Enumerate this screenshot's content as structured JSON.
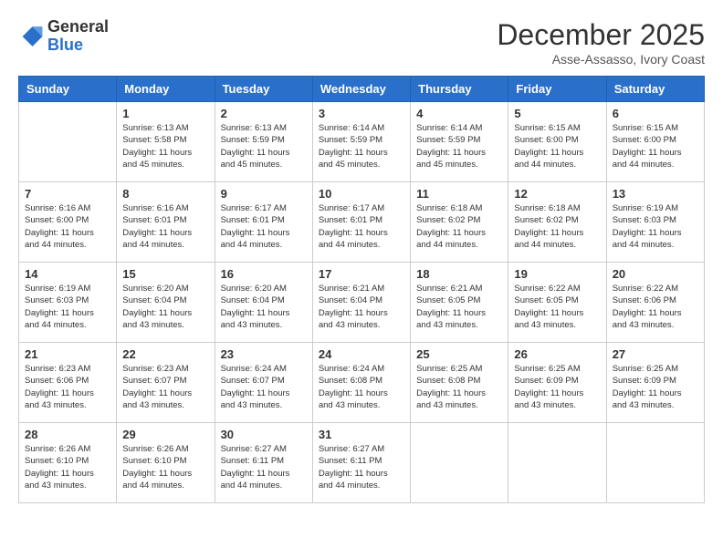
{
  "header": {
    "logo_general": "General",
    "logo_blue": "Blue",
    "month_title": "December 2025",
    "location": "Asse-Assasso, Ivory Coast"
  },
  "calendar": {
    "days_of_week": [
      "Sunday",
      "Monday",
      "Tuesday",
      "Wednesday",
      "Thursday",
      "Friday",
      "Saturday"
    ],
    "weeks": [
      [
        {
          "day": "",
          "info": ""
        },
        {
          "day": "1",
          "info": "Sunrise: 6:13 AM\nSunset: 5:58 PM\nDaylight: 11 hours\nand 45 minutes."
        },
        {
          "day": "2",
          "info": "Sunrise: 6:13 AM\nSunset: 5:59 PM\nDaylight: 11 hours\nand 45 minutes."
        },
        {
          "day": "3",
          "info": "Sunrise: 6:14 AM\nSunset: 5:59 PM\nDaylight: 11 hours\nand 45 minutes."
        },
        {
          "day": "4",
          "info": "Sunrise: 6:14 AM\nSunset: 5:59 PM\nDaylight: 11 hours\nand 45 minutes."
        },
        {
          "day": "5",
          "info": "Sunrise: 6:15 AM\nSunset: 6:00 PM\nDaylight: 11 hours\nand 44 minutes."
        },
        {
          "day": "6",
          "info": "Sunrise: 6:15 AM\nSunset: 6:00 PM\nDaylight: 11 hours\nand 44 minutes."
        }
      ],
      [
        {
          "day": "7",
          "info": "Sunrise: 6:16 AM\nSunset: 6:00 PM\nDaylight: 11 hours\nand 44 minutes."
        },
        {
          "day": "8",
          "info": "Sunrise: 6:16 AM\nSunset: 6:01 PM\nDaylight: 11 hours\nand 44 minutes."
        },
        {
          "day": "9",
          "info": "Sunrise: 6:17 AM\nSunset: 6:01 PM\nDaylight: 11 hours\nand 44 minutes."
        },
        {
          "day": "10",
          "info": "Sunrise: 6:17 AM\nSunset: 6:01 PM\nDaylight: 11 hours\nand 44 minutes."
        },
        {
          "day": "11",
          "info": "Sunrise: 6:18 AM\nSunset: 6:02 PM\nDaylight: 11 hours\nand 44 minutes."
        },
        {
          "day": "12",
          "info": "Sunrise: 6:18 AM\nSunset: 6:02 PM\nDaylight: 11 hours\nand 44 minutes."
        },
        {
          "day": "13",
          "info": "Sunrise: 6:19 AM\nSunset: 6:03 PM\nDaylight: 11 hours\nand 44 minutes."
        }
      ],
      [
        {
          "day": "14",
          "info": "Sunrise: 6:19 AM\nSunset: 6:03 PM\nDaylight: 11 hours\nand 44 minutes."
        },
        {
          "day": "15",
          "info": "Sunrise: 6:20 AM\nSunset: 6:04 PM\nDaylight: 11 hours\nand 43 minutes."
        },
        {
          "day": "16",
          "info": "Sunrise: 6:20 AM\nSunset: 6:04 PM\nDaylight: 11 hours\nand 43 minutes."
        },
        {
          "day": "17",
          "info": "Sunrise: 6:21 AM\nSunset: 6:04 PM\nDaylight: 11 hours\nand 43 minutes."
        },
        {
          "day": "18",
          "info": "Sunrise: 6:21 AM\nSunset: 6:05 PM\nDaylight: 11 hours\nand 43 minutes."
        },
        {
          "day": "19",
          "info": "Sunrise: 6:22 AM\nSunset: 6:05 PM\nDaylight: 11 hours\nand 43 minutes."
        },
        {
          "day": "20",
          "info": "Sunrise: 6:22 AM\nSunset: 6:06 PM\nDaylight: 11 hours\nand 43 minutes."
        }
      ],
      [
        {
          "day": "21",
          "info": "Sunrise: 6:23 AM\nSunset: 6:06 PM\nDaylight: 11 hours\nand 43 minutes."
        },
        {
          "day": "22",
          "info": "Sunrise: 6:23 AM\nSunset: 6:07 PM\nDaylight: 11 hours\nand 43 minutes."
        },
        {
          "day": "23",
          "info": "Sunrise: 6:24 AM\nSunset: 6:07 PM\nDaylight: 11 hours\nand 43 minutes."
        },
        {
          "day": "24",
          "info": "Sunrise: 6:24 AM\nSunset: 6:08 PM\nDaylight: 11 hours\nand 43 minutes."
        },
        {
          "day": "25",
          "info": "Sunrise: 6:25 AM\nSunset: 6:08 PM\nDaylight: 11 hours\nand 43 minutes."
        },
        {
          "day": "26",
          "info": "Sunrise: 6:25 AM\nSunset: 6:09 PM\nDaylight: 11 hours\nand 43 minutes."
        },
        {
          "day": "27",
          "info": "Sunrise: 6:25 AM\nSunset: 6:09 PM\nDaylight: 11 hours\nand 43 minutes."
        }
      ],
      [
        {
          "day": "28",
          "info": "Sunrise: 6:26 AM\nSunset: 6:10 PM\nDaylight: 11 hours\nand 43 minutes."
        },
        {
          "day": "29",
          "info": "Sunrise: 6:26 AM\nSunset: 6:10 PM\nDaylight: 11 hours\nand 44 minutes."
        },
        {
          "day": "30",
          "info": "Sunrise: 6:27 AM\nSunset: 6:11 PM\nDaylight: 11 hours\nand 44 minutes."
        },
        {
          "day": "31",
          "info": "Sunrise: 6:27 AM\nSunset: 6:11 PM\nDaylight: 11 hours\nand 44 minutes."
        },
        {
          "day": "",
          "info": ""
        },
        {
          "day": "",
          "info": ""
        },
        {
          "day": "",
          "info": ""
        }
      ]
    ]
  }
}
